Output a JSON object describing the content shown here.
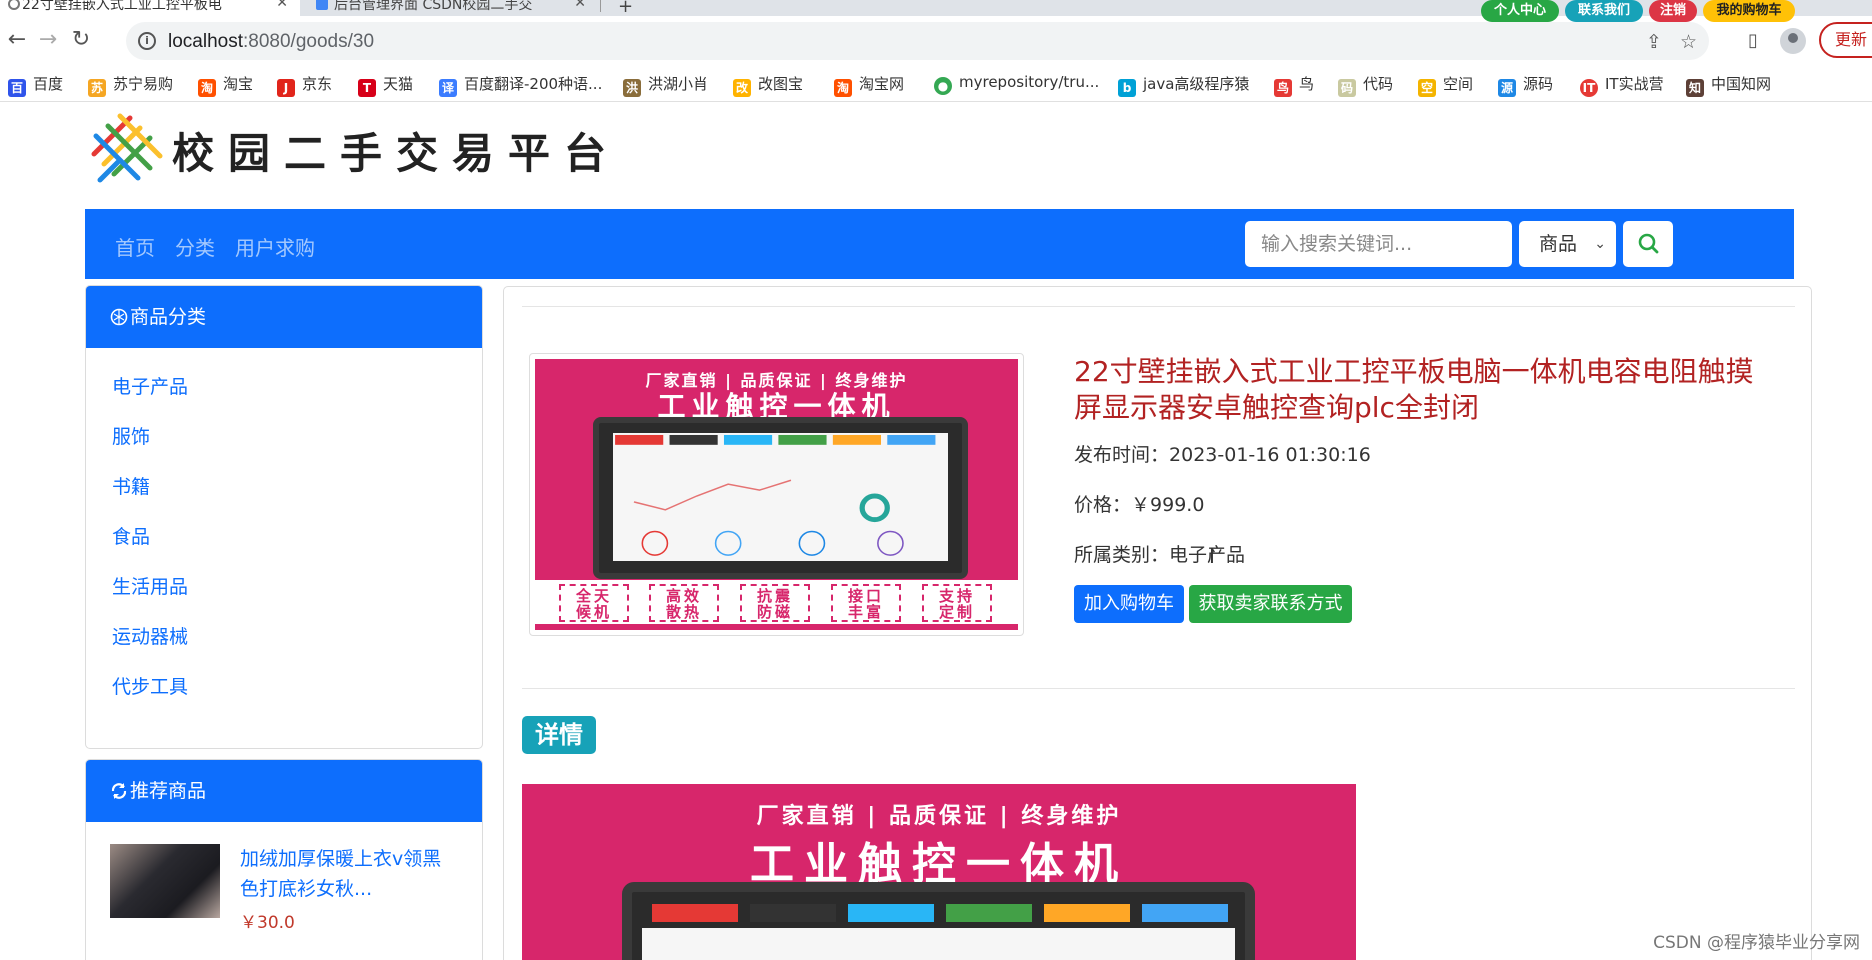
{
  "browser": {
    "tabs": [
      {
        "label": "22寸壁挂嵌入式工业工控平板电"
      },
      {
        "label": "后台管理界面 CSDN校园二手交"
      }
    ],
    "url_host": "localhost",
    "url_path": ":8080/goods/30",
    "update_label": "更新",
    "bookmarks": [
      "百度",
      "苏宁易购",
      "淘宝",
      "京东",
      "天猫",
      "百度翻译-200种语...",
      "洪湖小肖",
      "改图宝",
      "淘宝网",
      "myrepository/tru...",
      "java高级程序猿",
      "鸟",
      "代码",
      "空间",
      "源码",
      "IT实战营",
      "中国知网"
    ]
  },
  "header": {
    "site_title": "校园二手交易平台",
    "user_links": [
      {
        "label": "个人中心",
        "color": "#28a745"
      },
      {
        "label": "联系我们",
        "color": "#17a2b8"
      },
      {
        "label": "注销",
        "color": "#dc3545"
      },
      {
        "label": "我的购物车",
        "color": "#ffc107"
      }
    ]
  },
  "nav": {
    "links": [
      "首页",
      "分类",
      "用户求购"
    ],
    "search_placeholder": "输入搜索关键词...",
    "search_type": "商品"
  },
  "sidebar": {
    "categories_title": "商品分类",
    "categories": [
      "电子产品",
      "服饰",
      "书籍",
      "食品",
      "生活用品",
      "运动器械",
      "代步工具"
    ],
    "recommend_title": "推荐商品",
    "recommend": [
      {
        "title": "加绒加厚保暖上衣v领黑色打底衫女秋...",
        "price": "￥30.0"
      }
    ]
  },
  "product": {
    "title": "22寸壁挂嵌入式工业工控平板电脑一体机电容电阻触摸屏显示器安卓触控查询plc全封闭",
    "publish_label": "发布时间：",
    "publish_time": "2023-01-16 01:30:16",
    "price_label": "价格：",
    "price": "￥999.0",
    "category_label": "所属类别：",
    "category": "电子产品",
    "add_cart_label": "加入购物车",
    "contact_label": "获取卖家联系方式",
    "image": {
      "top_line": "厂家直销 | 品质保证 | 终身维护",
      "headline": "工业触控一体机",
      "tags": [
        "全天\n候机",
        "高效\n散热",
        "抗震\n防磁",
        "接口\n丰富",
        "支持\n定制"
      ]
    }
  },
  "detail": {
    "label": "详情"
  },
  "watermark": "CSDN @程序猿毕业分享网",
  "colors": {
    "primary": "#0d6efd",
    "price": "#c0392b",
    "title": "#b22222",
    "contact_button": "#28a745",
    "detail_badge": "#17a2b8"
  }
}
